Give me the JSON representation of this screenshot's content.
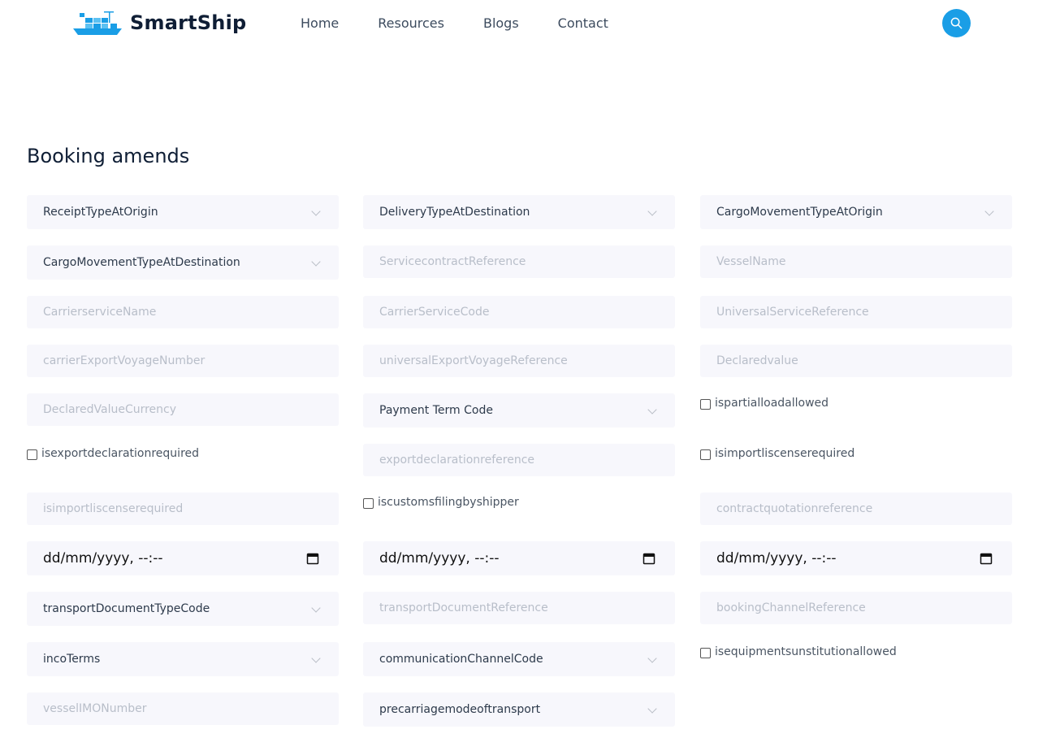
{
  "brand": {
    "name": "SmartShip"
  },
  "nav": {
    "items": [
      "Home",
      "Resources",
      "Blogs",
      "Contact"
    ]
  },
  "icons": {
    "logo": "ship-icon",
    "search": "search-icon",
    "dropdown": "chevron-down-icon",
    "calendar": "calendar-icon"
  },
  "colors": {
    "accent": "#1a9ee6",
    "field_bg": "#f7f7fc",
    "title": "#0f1e35"
  },
  "page": {
    "title": "Booking amends"
  },
  "form": {
    "receipt_type_at_origin": "ReceiptTypeAtOrigin",
    "delivery_type_at_destination": "DeliveryTypeAtDestination",
    "cargo_movement_type_at_origin": "CargoMovementTypeAtOrigin",
    "cargo_movement_type_at_destination": "CargoMovementTypeAtDestination",
    "service_contract_reference": "ServicecontractReference",
    "vessel_name": "VesselName",
    "carrier_service_name": "CarrierserviceName",
    "carrier_service_code": "CarrierServiceCode",
    "universal_service_reference": "UniversalServiceReference",
    "carrier_export_voyage_number": "carrierExportVoyageNumber",
    "universal_export_voyage_reference": "universalExportVoyageReference",
    "declared_value": "Declaredvalue",
    "declared_value_currency": "DeclaredValueCurrency",
    "payment_term_code": "Payment Term Code",
    "is_partial_load_allowed": "ispartialloadallowed",
    "is_export_declaration_required": "isexportdeclarationrequired",
    "export_declaration_reference": "exportdeclarationreference",
    "is_import_liscense_required_checkbox": "isimportliscenserequired",
    "is_import_liscense_required_input": "isimportliscenserequired",
    "is_customs_filing_by_shipper": "iscustomsfilingbyshipper",
    "contract_quotation_reference": "contractquotationreference",
    "date_1": "dd/mm/yyyy, --:--",
    "date_2": "dd/mm/yyyy, --:--",
    "date_3": "dd/mm/yyyy, --:--",
    "transport_document_type_code": "transportDocumentTypeCode",
    "transport_document_reference": "transportDocumentReference",
    "booking_channel_reference": "bookingChannelReference",
    "inco_terms": "incoTerms",
    "communication_channel_code": "communicationChannelCode",
    "is_equipment_substitution_allowed": "isequipmentsunstitutionallowed",
    "vessel_imo_number": "vesselIMONumber",
    "pre_carriage_mode_of_transport": "precarriagemodeoftransport"
  }
}
